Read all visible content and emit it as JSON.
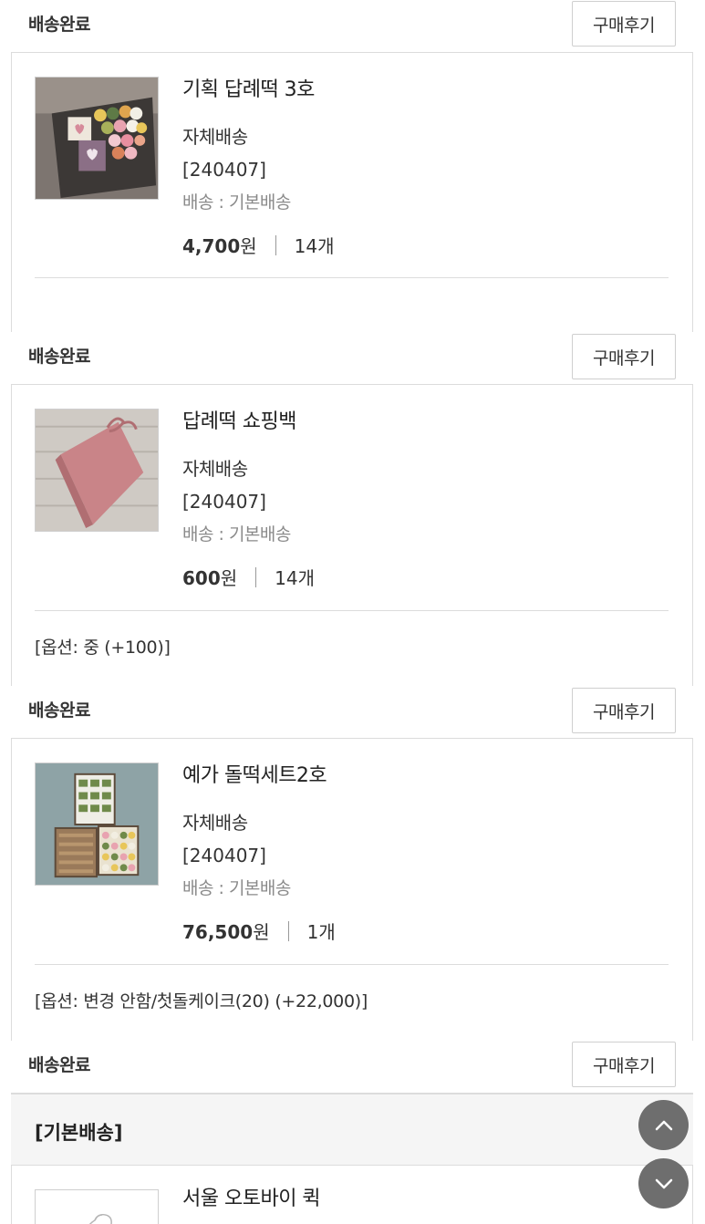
{
  "orders": [
    {
      "status": "배송완료",
      "review_label": "구매후기",
      "name": "기획 답례떡 3호",
      "ship_type": "자체배송",
      "code": "[240407]",
      "method": "배송 : 기본배송",
      "price": "4,700",
      "currency": "원",
      "qty": "14개",
      "option": ""
    },
    {
      "status": "배송완료",
      "review_label": "구매후기",
      "name": "답례떡 쇼핑백",
      "ship_type": "자체배송",
      "code": "[240407]",
      "method": "배송 : 기본배송",
      "price": "600",
      "currency": "원",
      "qty": "14개",
      "option": "[옵션: 중 (+100)]"
    },
    {
      "status": "배송완료",
      "review_label": "구매후기",
      "name": "예가 돌떡세트2호",
      "ship_type": "자체배송",
      "code": "[240407]",
      "method": "배송 : 기본배송",
      "price": "76,500",
      "currency": "원",
      "qty": "1개",
      "option": "[옵션: 변경 안함/첫돌케이크(20) (+22,000)]"
    },
    {
      "status": "배송완료",
      "review_label": "구매후기",
      "name": "서울 오토바이 퀵"
    }
  ],
  "basic_shipping_header": "[기본배송]",
  "icons": {
    "scroll_up": "chevron-up-icon",
    "scroll_down": "chevron-down-icon"
  },
  "colors": {
    "border": "#dcdcdc",
    "float_button": "#6e6e6e",
    "muted_text": "#8a8a8a"
  }
}
